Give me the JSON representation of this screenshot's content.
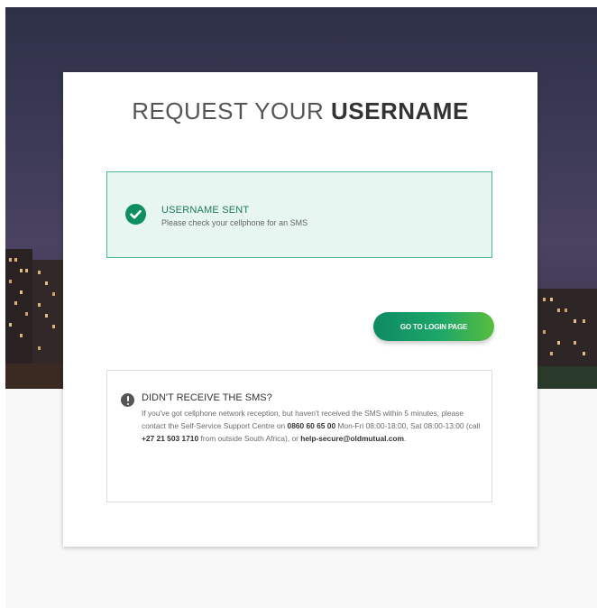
{
  "card": {
    "title_light": "REQUEST YOUR ",
    "title_bold": "USERNAME"
  },
  "success_alert": {
    "icon": "check-circle-icon",
    "title": "USERNAME SENT",
    "message": "Please check your cellphone for an SMS"
  },
  "login_button": {
    "label": "GO TO LOGIN PAGE"
  },
  "info_box": {
    "icon": "info-circle-icon",
    "title": "DIDN'T RECEIVE THE SMS?",
    "text_1": "If you've got cellphone network reception, but haven't received the SMS within 5 minutes, please contact the Self-Service Support Centre on ",
    "phone_local": "0860 60 65 00",
    "text_2": " Mon-Fri 08:00-18:00, Sat 08:00-13:00 (call ",
    "phone_international": "+27 21 503 1710",
    "text_3": " from outside South Africa), or ",
    "email": "help-secure@oldmutual.com",
    "text_4": "."
  },
  "colors": {
    "accent_green": "#0f8f60",
    "alert_background": "#e8f6f2",
    "alert_border": "#4fb79a",
    "hero_top": "#2e3047"
  }
}
